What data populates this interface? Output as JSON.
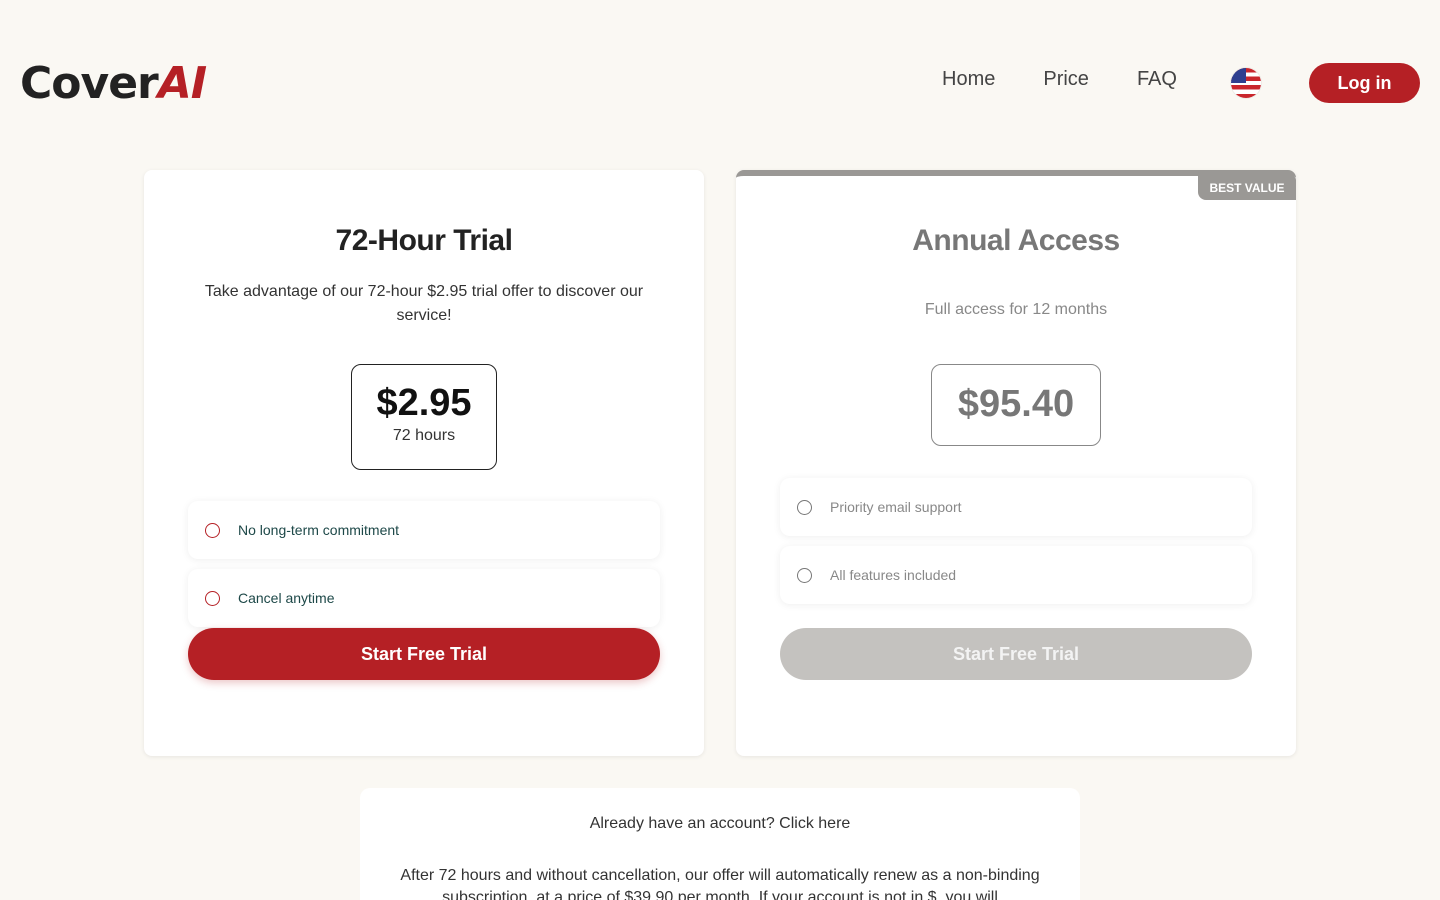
{
  "brand": {
    "name_main": "Cover",
    "name_accent": "AI",
    "accent_color": "#b52025"
  },
  "nav": {
    "items": [
      {
        "label": "Home"
      },
      {
        "label": "Price"
      },
      {
        "label": "FAQ"
      }
    ],
    "language_icon": "us-flag-icon",
    "login_label": "Log in"
  },
  "trial": {
    "title": "72-Hour Trial",
    "description": "Take advantage of our 72-hour $2.95 trial offer to discover our service!",
    "price": "$2.95",
    "period": "72 hours",
    "features": [
      {
        "label": "No long-term commitment"
      },
      {
        "label": "Cancel anytime"
      }
    ],
    "cta_label": "Start Free Trial"
  },
  "annual": {
    "badge": "BEST VALUE",
    "title": "Annual Access",
    "description": "Full access for 12 months",
    "price": "$95.40",
    "features": [
      {
        "label": "Priority email support"
      },
      {
        "label": "All features included"
      }
    ],
    "cta_label": "Start Free Trial"
  },
  "footer_info": {
    "already_account": "Already have an account? Click here",
    "renew_text": "After 72 hours and without cancellation, our offer will automatically renew as a non-binding subscription, at a price of $39.90 per month. If your account is not in $, you will"
  }
}
